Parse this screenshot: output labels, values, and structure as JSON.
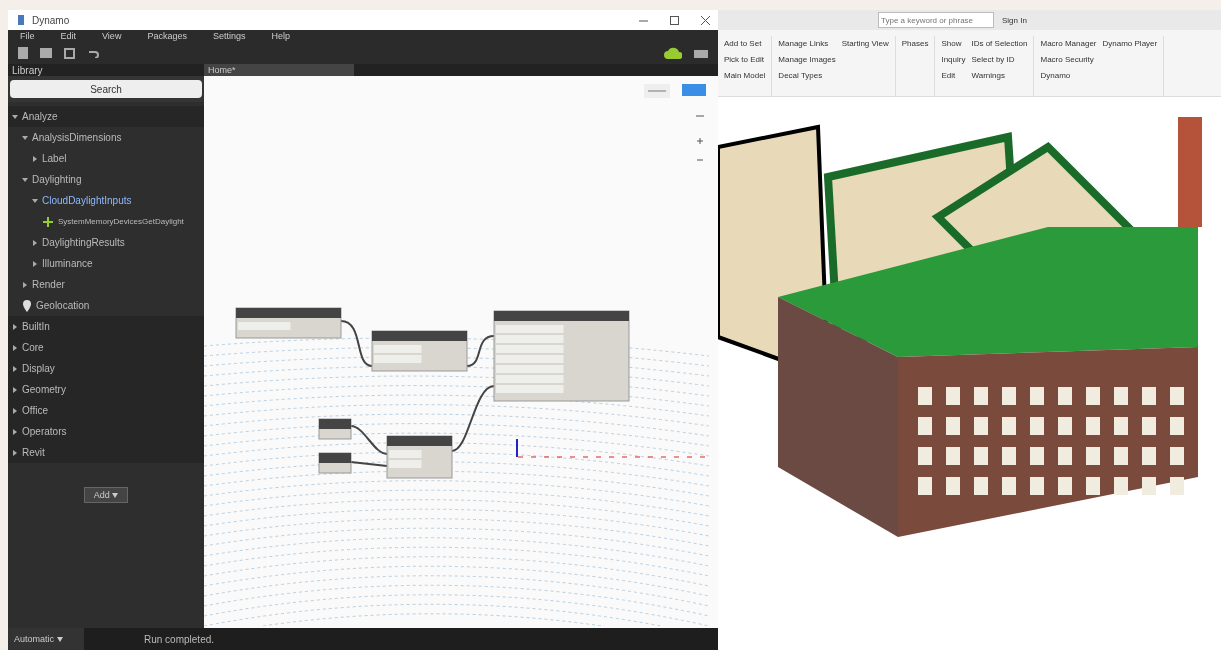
{
  "dynamo": {
    "title": "Dynamo",
    "menu": [
      "File",
      "Edit",
      "View",
      "Packages",
      "Settings",
      "Help"
    ],
    "library": {
      "title": "Library",
      "search": {
        "placeholder": "Search"
      },
      "items": [
        {
          "label": "Analyze",
          "expanded": true,
          "children": [
            {
              "label": "AnalysisDimensions",
              "expanded": true,
              "children": [
                {
                  "label": "Label",
                  "expanded": false
                }
              ]
            },
            {
              "label": "Daylighting",
              "expanded": true,
              "children": [
                {
                  "label": "CloudDaylightInputs",
                  "expanded": true,
                  "selected": true,
                  "children": [
                    {
                      "label": "SystemMemoryDevicesGetDaylight",
                      "kind": "node"
                    }
                  ]
                },
                {
                  "label": "DaylightingResults",
                  "expanded": false
                },
                {
                  "label": "Illuminance",
                  "expanded": false
                }
              ]
            },
            {
              "label": "Render",
              "expanded": false
            },
            {
              "label": "Geolocation",
              "kind": "location"
            }
          ]
        },
        {
          "label": "BuiltIn",
          "expanded": false
        },
        {
          "label": "Core",
          "expanded": false
        },
        {
          "label": "Display",
          "expanded": false
        },
        {
          "label": "Geometry",
          "expanded": false
        },
        {
          "label": "Office",
          "expanded": false
        },
        {
          "label": "Operators",
          "expanded": false
        },
        {
          "label": "Revit",
          "expanded": false
        }
      ],
      "add_button": "Add"
    },
    "tabs": [
      {
        "label": "Home*",
        "selected": true
      }
    ],
    "run_mode": "Automatic",
    "status": "Run completed."
  },
  "revit": {
    "search": {
      "placeholder": "Type a keyword or phrase"
    },
    "sign_in": "Sign In",
    "ribbon": [
      {
        "items": [
          "Add to Set",
          "Pick to Edit",
          "Main Model"
        ]
      },
      {
        "items": [
          "Manage Links",
          "Manage Images",
          "Decal Types",
          "Starting View"
        ]
      },
      {
        "items": [
          "Phases"
        ]
      },
      {
        "items": [
          "Show",
          "Inquiry",
          "Edit",
          "IDs of Selection",
          "Select by ID",
          "Warnings"
        ]
      },
      {
        "items": [
          "Macro Manager",
          "Macro Security",
          "Dynamo",
          "Dynamo Player"
        ]
      }
    ]
  }
}
